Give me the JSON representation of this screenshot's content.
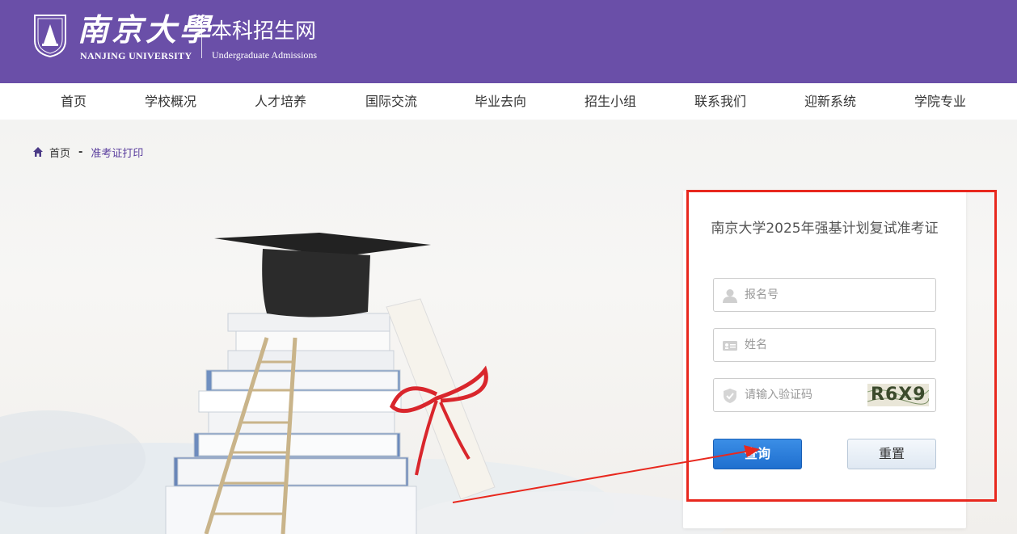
{
  "header": {
    "logo_cn": "南京大學",
    "logo_en": "NANJING UNIVERSITY",
    "site_title": "本科招生网",
    "site_subtitle": "Undergraduate Admissions"
  },
  "nav": [
    {
      "label": "首页"
    },
    {
      "label": "学校概况"
    },
    {
      "label": "人才培养"
    },
    {
      "label": "国际交流"
    },
    {
      "label": "毕业去向"
    },
    {
      "label": "招生小组"
    },
    {
      "label": "联系我们"
    },
    {
      "label": "迎新系统"
    },
    {
      "label": "学院专业"
    }
  ],
  "breadcrumb": {
    "home": "首页",
    "separator": "-",
    "current": "准考证打印"
  },
  "form": {
    "title": "南京大学2025年强基计划复试准考证",
    "reg_no_placeholder": "报名号",
    "name_placeholder": "姓名",
    "captcha_placeholder": "请输入验证码",
    "captcha_text": "R6X9",
    "query_label": "查询",
    "reset_label": "重置"
  },
  "colors": {
    "brand_purple": "#6a4fa8",
    "annotation_red": "#e8281e",
    "query_blue": "#2a7fdc"
  },
  "icons": {
    "home": "home-icon",
    "user": "user-icon",
    "id_card": "id-card-icon",
    "shield": "shield-icon"
  }
}
